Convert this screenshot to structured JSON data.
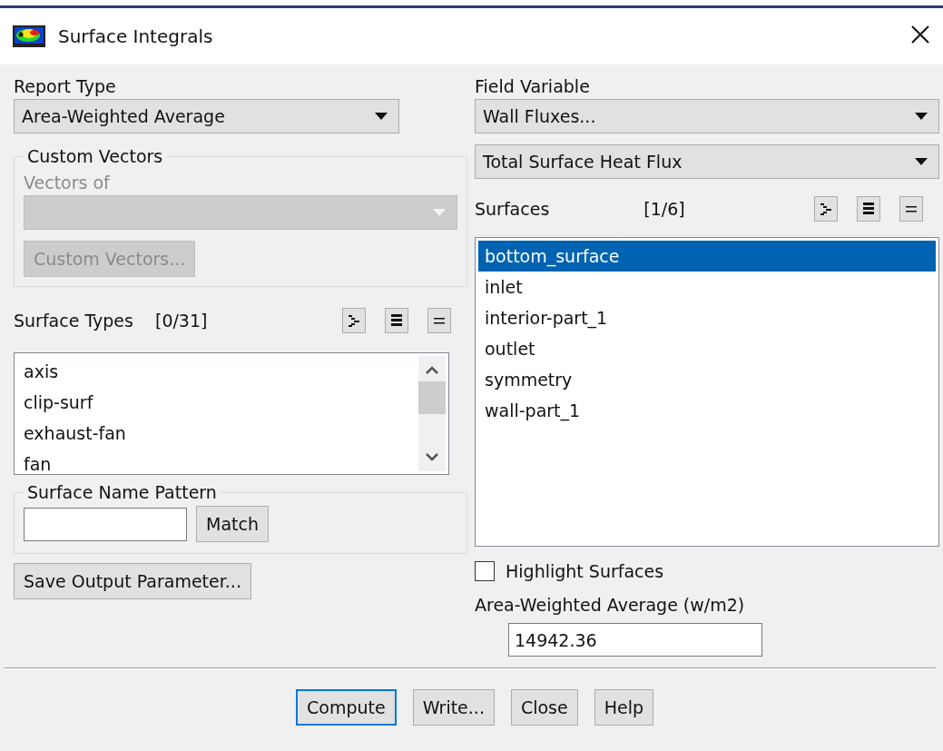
{
  "window": {
    "title": "Surface Integrals"
  },
  "report_type": {
    "label": "Report Type",
    "value": "Area-Weighted Average"
  },
  "custom_vectors": {
    "title": "Custom Vectors",
    "field_label": "Vectors of",
    "button": "Custom Vectors...",
    "disabled": true
  },
  "surface_types": {
    "label": "Surface Types",
    "count": "[0/31]",
    "items": [
      {
        "label": "axis",
        "selected": false
      },
      {
        "label": "clip-surf",
        "selected": false
      },
      {
        "label": "exhaust-fan",
        "selected": false
      },
      {
        "label": "fan",
        "selected": false
      }
    ]
  },
  "surface_name_pattern": {
    "title": "Surface Name Pattern",
    "button": "Match"
  },
  "save_button": "Save Output Parameter...",
  "field_variable": {
    "label": "Field Variable",
    "category": "Wall Fluxes...",
    "value": "Total Surface Heat Flux"
  },
  "surfaces": {
    "label": "Surfaces",
    "count": "[1/6]",
    "items": [
      {
        "label": "bottom_surface",
        "selected": true
      },
      {
        "label": "inlet",
        "selected": false
      },
      {
        "label": "interior-part_1",
        "selected": false
      },
      {
        "label": "outlet",
        "selected": false
      },
      {
        "label": "symmetry",
        "selected": false
      },
      {
        "label": "wall-part_1",
        "selected": false
      }
    ]
  },
  "highlight_surfaces": {
    "label": "Highlight Surfaces",
    "checked": false
  },
  "result": {
    "label": "Area-Weighted Average (w/m2)",
    "value": "14942.36"
  },
  "buttons": [
    {
      "label": "Compute",
      "focused": true
    },
    {
      "label": "Write...",
      "focused": false
    },
    {
      "label": "Close",
      "focused": false
    },
    {
      "label": "Help",
      "focused": false
    }
  ]
}
